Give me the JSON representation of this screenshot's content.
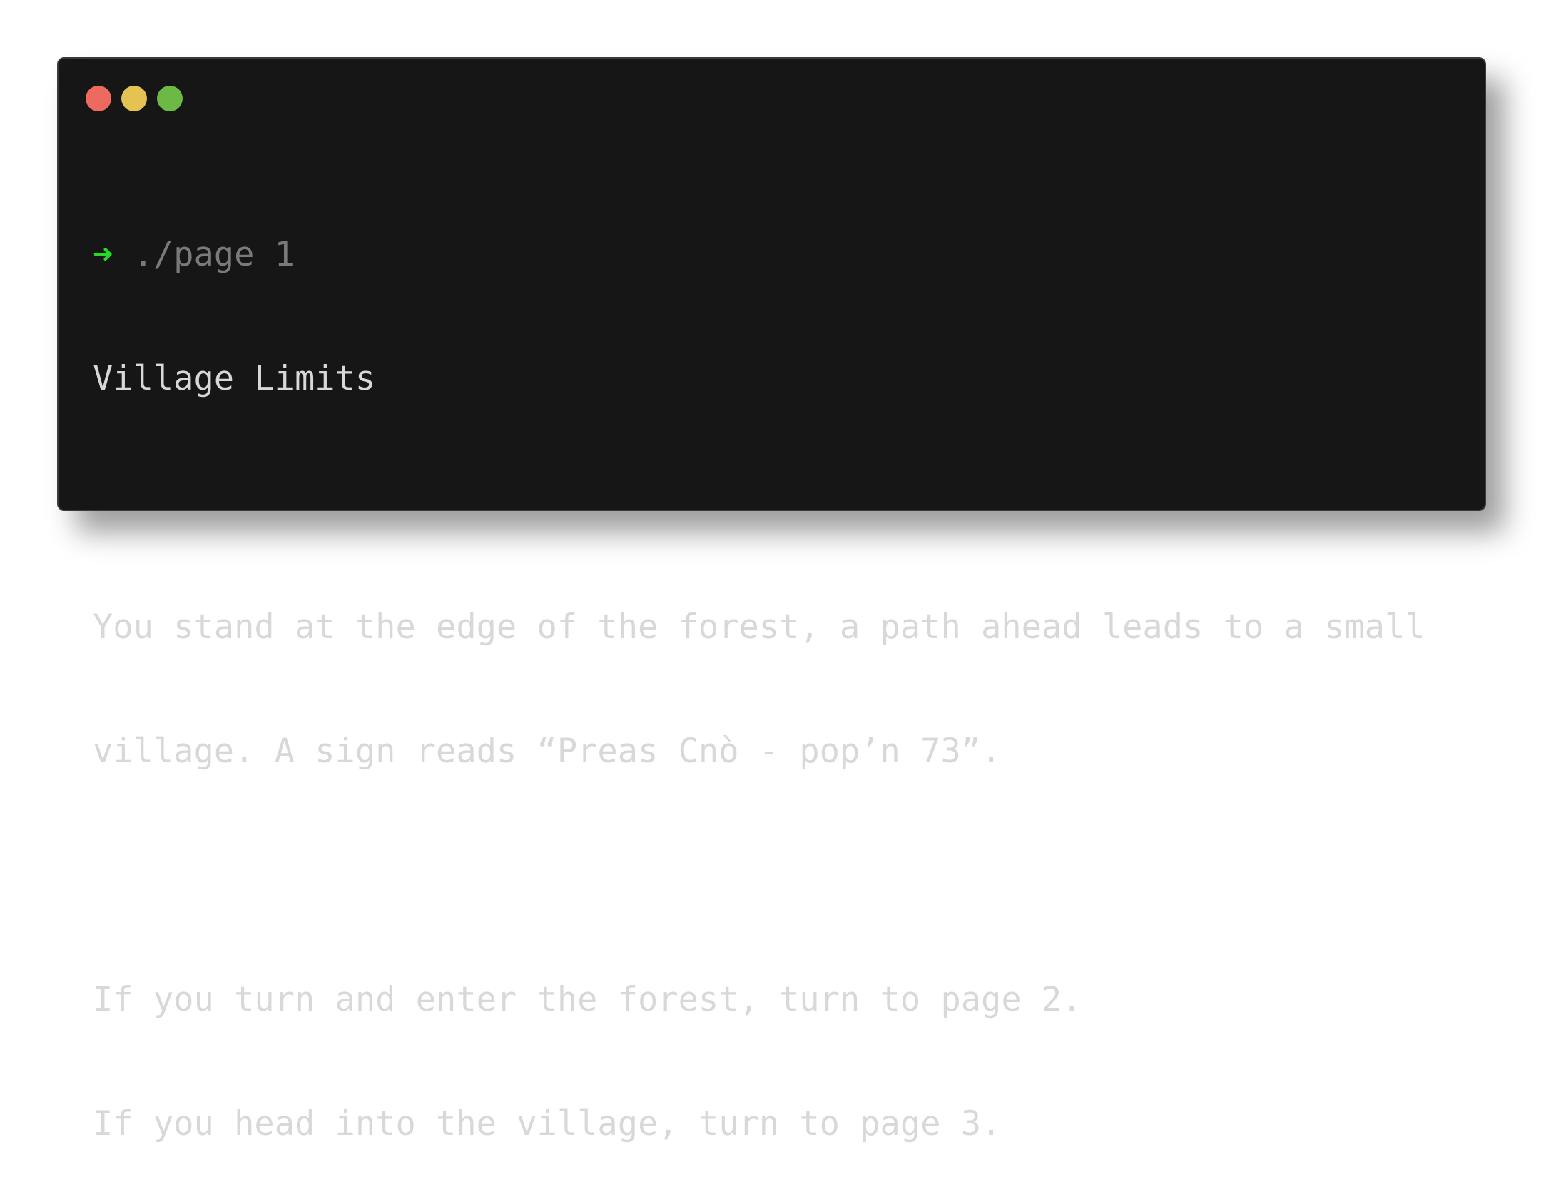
{
  "window": {
    "buttons": [
      {
        "name": "close",
        "color": "#ee6a5f"
      },
      {
        "name": "minimize",
        "color": "#e5c352"
      },
      {
        "name": "maximize",
        "color": "#6cba45"
      }
    ]
  },
  "terminal": {
    "prompt_symbol": "➜",
    "prompt_color": "#22dd22",
    "command": " ./page 1",
    "title": "Village Limits",
    "description_line1": "You stand at the edge of the forest, a path ahead leads to a small",
    "description_line2": "village. A sign reads “Preas Cnò - pop’n 73”.",
    "choice1": "If you turn and enter the forest, turn to page 2.",
    "choice2": "If you head into the village, turn to page 3."
  }
}
